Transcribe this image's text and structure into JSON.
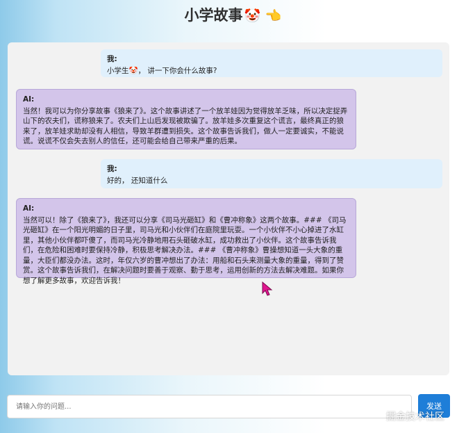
{
  "header": {
    "title": "小学故事",
    "emojis": "🤡 👈"
  },
  "messages": [
    {
      "role": "user",
      "speaker": "我:",
      "text": "小学生🤡， 讲一下你会什么故事?"
    },
    {
      "role": "ai",
      "speaker": "AI:",
      "text": "当然！我可以为你分享故事《狼来了》。这个故事讲述了一个放羊娃因为觉得放羊乏味，所以决定捉弄山下的农夫们，谎称狼来了。农夫们上山后发现被欺骗了。放羊娃多次重复这个谎言，最终真正的狼来了，放羊娃求助却没有人相信，导致羊群遭到损失。这个故事告诉我们，做人一定要诚实，不能说谎。说谎不仅会失去别人的信任，还可能会给自己带来严重的后果。"
    },
    {
      "role": "user",
      "speaker": "我:",
      "text": "好的， 还知道什么"
    },
    {
      "role": "ai",
      "speaker": "AI:",
      "text": "当然可以！除了《狼来了》，我还可以分享《司马光砸缸》和《曹冲称象》这两个故事。### 《司马光砸缸》在一个阳光明媚的日子里，司马光和小伙伴们在庭院里玩耍。一个小伙伴不小心掉进了水缸里，其他小伙伴都吓傻了，而司马光冷静地用石头砸破水缸，成功救出了小伙伴。这个故事告诉我们，在危险和困难时要保持冷静，积极思考解决办法。### 《曹冲称象》曹操想知道一头大象的重量，大臣们都没办法。这时，年仅六岁的曹冲想出了办法：用船和石头来测量大象的重量，得到了赞赏。这个故事告诉我们，在解决问题时要善于观察、勤于思考，运用创新的方法去解决难题。如果你想了解更多故事，欢迎告诉我！"
    }
  ],
  "input": {
    "placeholder": "请输入你的问题..."
  },
  "send_button": {
    "label": "发送"
  },
  "watermark": "掘金技术社区",
  "colors": {
    "accent": "#1e7ed8",
    "ai_bubble": "#d3c5ea",
    "user_bubble": "#e0f0fc",
    "cursor": "#e0168f"
  }
}
